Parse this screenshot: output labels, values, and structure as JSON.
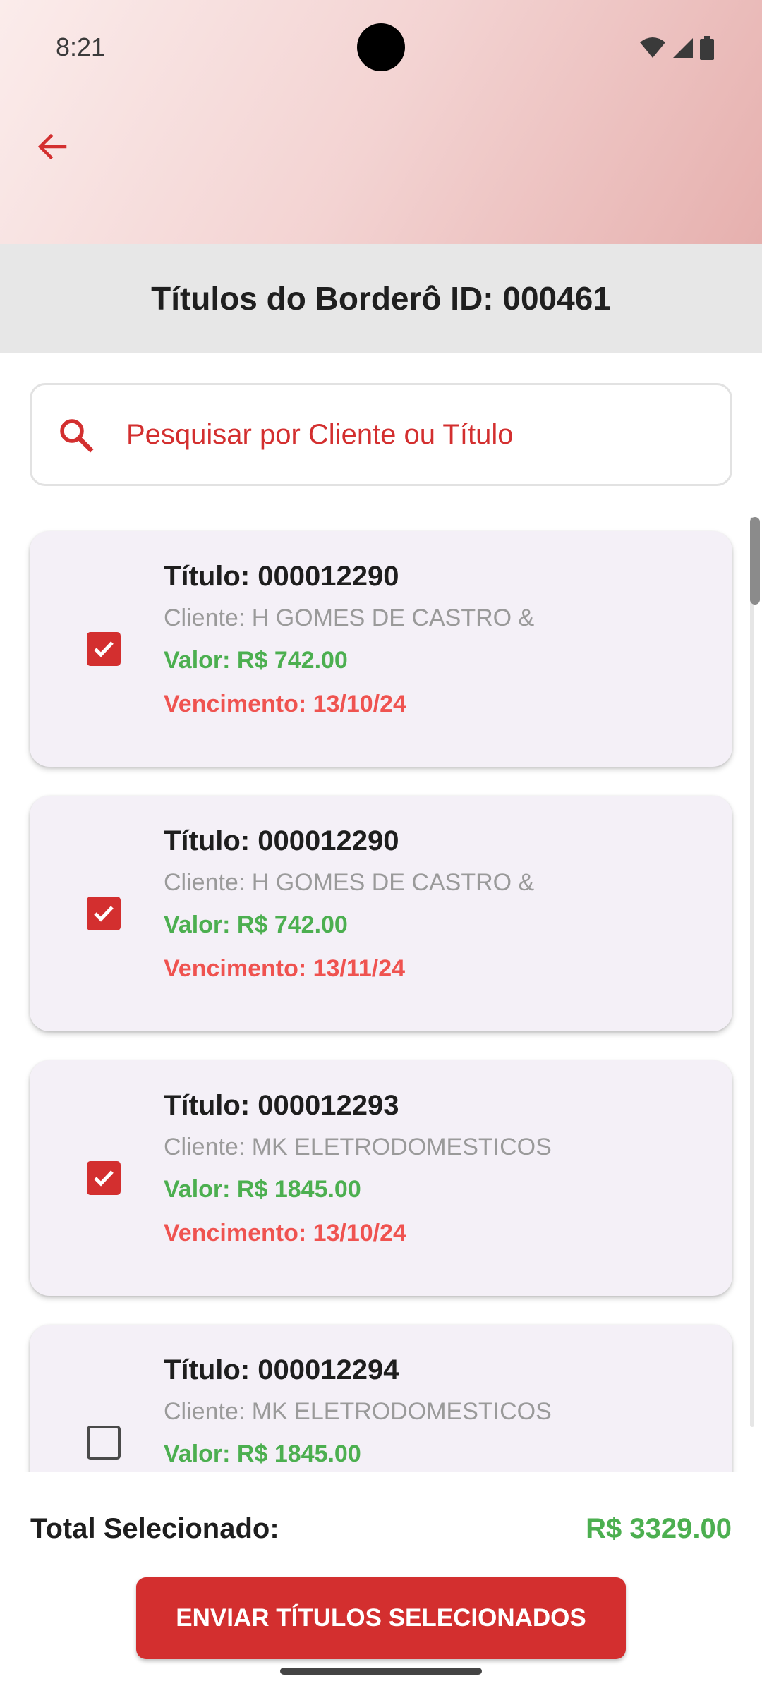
{
  "status_bar": {
    "time": "8:21"
  },
  "header": {
    "title": "Títulos do Borderô ID: 000461"
  },
  "search": {
    "placeholder": "Pesquisar por Cliente ou Título"
  },
  "titles": [
    {
      "title": "Título: 000012290",
      "client": "Cliente: H GOMES DE CASTRO &",
      "value": "Valor: R$ 742.00",
      "due": "Vencimento: 13/10/24",
      "checked": true
    },
    {
      "title": "Título: 000012290",
      "client": "Cliente: H GOMES DE CASTRO &",
      "value": "Valor: R$ 742.00",
      "due": "Vencimento: 13/11/24",
      "checked": true
    },
    {
      "title": "Título: 000012293",
      "client": "Cliente: MK ELETRODOMESTICOS",
      "value": "Valor: R$ 1845.00",
      "due": "Vencimento: 13/10/24",
      "checked": true
    },
    {
      "title": "Título: 000012294",
      "client": "Cliente: MK ELETRODOMESTICOS",
      "value": "Valor: R$ 1845.00",
      "due": "",
      "checked": false
    }
  ],
  "footer": {
    "total_label": "Total Selecionado:",
    "total_value": "R$ 3329.00",
    "send_label": "ENVIAR TÍTULOS SELECIONADOS"
  },
  "colors": {
    "accent": "#d32f2f",
    "value_green": "#4caf50",
    "due_red": "#ef5350",
    "card_bg": "#f4f0f7"
  }
}
